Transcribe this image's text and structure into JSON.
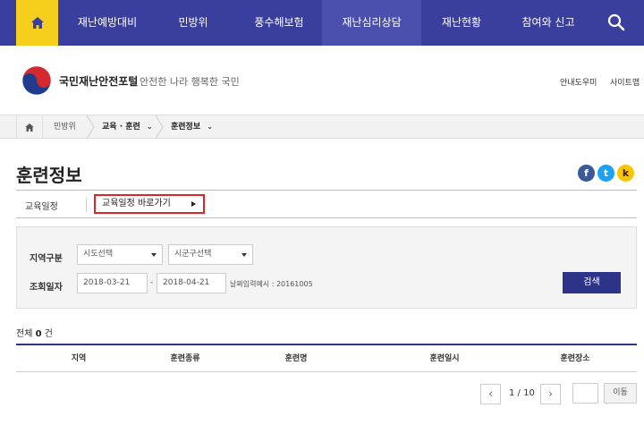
{
  "nav": {
    "items": [
      "재난예방대비",
      "민방위",
      "풍수해보험",
      "재난심리상담",
      "재난현황",
      "참여와 신고"
    ]
  },
  "header": {
    "brand": "국민재난안전포털",
    "slogan": "안전한 나라 행복한 국민",
    "util_links": [
      "안내도우미",
      "사이트맵"
    ]
  },
  "breadcrumb": {
    "items": [
      "민방위",
      "교육 · 훈련",
      "훈련정보"
    ]
  },
  "page": {
    "title": "훈련정보"
  },
  "share": {
    "facebook": "f",
    "twitter": "t",
    "kakao": "k"
  },
  "schedule": {
    "label": "교육일정",
    "link": "교육일정 바로가기"
  },
  "search": {
    "region_label": "지역구분",
    "sido_select": "시도선택",
    "sigungu_select": "시군구선택",
    "date_label": "조회일자",
    "date_from": "2018-03-21",
    "date_to": "2018-04-21",
    "dash": "-",
    "date_hint": "날짜입력예시 : 20161005",
    "submit": "검색"
  },
  "results": {
    "total_prefix": "전체",
    "total_count": "0",
    "total_suffix": "건",
    "columns": [
      "지역",
      "훈련종류",
      "훈련명",
      "훈련일시",
      "훈련장소"
    ]
  },
  "pagination": {
    "prev": "‹",
    "next": "›",
    "status": "1 / 10",
    "go": "이동"
  },
  "colors": {
    "nav_bg": "#3a3f9e",
    "home_accent": "#f5cf1b",
    "primary": "#2d3388",
    "highlight_border": "#d9262b"
  }
}
